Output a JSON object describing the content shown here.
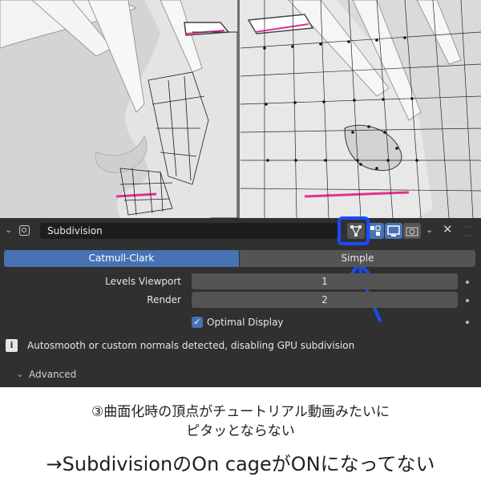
{
  "modifier": {
    "name": "Subdivision",
    "modes": [
      "Catmull-Clark",
      "Simple"
    ],
    "active_mode": "Catmull-Clark",
    "on_cage_enabled": false
  },
  "properties": {
    "levels_viewport_label": "Levels Viewport",
    "levels_viewport_value": "1",
    "render_label": "Render",
    "render_value": "2",
    "optimal_display_label": "Optimal Display",
    "optimal_display_checked": true
  },
  "info_message": "Autosmooth or custom normals detected, disabling GPU subdivision",
  "advanced_label": "Advanced",
  "caption": {
    "line1": "③曲面化時の頂点がチュートリアル動画みたいに",
    "line2": "ピタッとならない",
    "line3": "→SubdivisionのOn cageがONになってない"
  },
  "colors": {
    "panel_bg": "#303030",
    "accent_blue": "#4772b3",
    "annotation_blue": "#1a4bff",
    "seam_pink": "#e0318f"
  },
  "icons": {
    "collapse": "chevron-down-icon",
    "modifier_type": "subdivision-modifier-icon",
    "on_cage": "on-cage-vertex-icon",
    "edit_mode": "edit-mode-icon",
    "realtime": "monitor-icon",
    "render": "camera-icon",
    "menu": "chevron-down-icon",
    "remove": "close-icon",
    "drag": "drag-handle-icon",
    "info": "info-icon",
    "advanced": "chevron-right-icon"
  }
}
